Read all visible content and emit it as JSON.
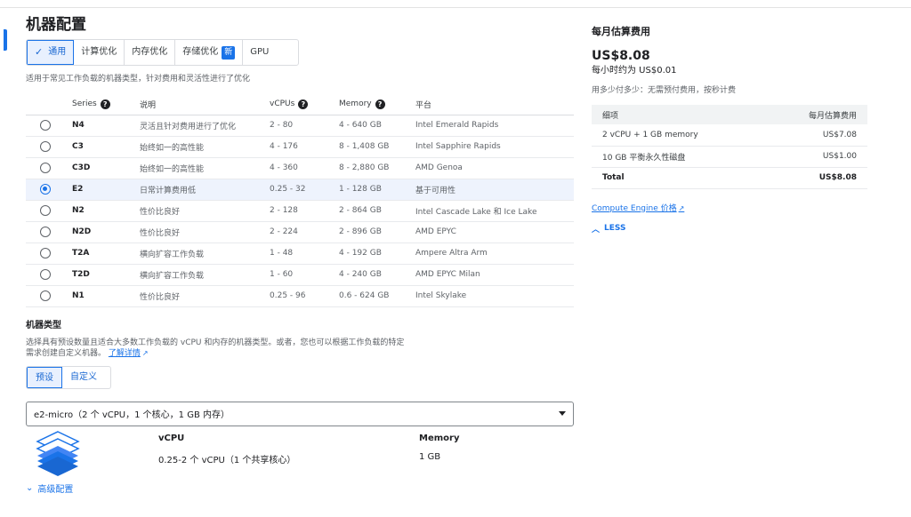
{
  "page": {
    "title": "机器配置"
  },
  "tabs": [
    {
      "label": "通用",
      "active": true
    },
    {
      "label": "计算优化"
    },
    {
      "label": "内存优化"
    },
    {
      "label": "存储优化",
      "badge": "新"
    },
    {
      "label": "GPU"
    }
  ],
  "tab_description": "适用于常见工作负载的机器类型，针对费用和灵活性进行了优化",
  "series_table": {
    "headers": {
      "series": "Series",
      "description": "说明",
      "vcpus": "vCPUs",
      "memory": "Memory",
      "platform": "平台"
    },
    "rows": [
      {
        "series": "N4",
        "description": "灵活且针对费用进行了优化",
        "vcpus": "2 - 80",
        "memory": "4 - 640 GB",
        "platform": "Intel Emerald Rapids",
        "selected": false
      },
      {
        "series": "C3",
        "description": "始终如一的高性能",
        "vcpus": "4 - 176",
        "memory": "8 - 1,408 GB",
        "platform": "Intel Sapphire Rapids",
        "selected": false
      },
      {
        "series": "C3D",
        "description": "始终如一的高性能",
        "vcpus": "4 - 360",
        "memory": "8 - 2,880 GB",
        "platform": "AMD Genoa",
        "selected": false
      },
      {
        "series": "E2",
        "description": "日常计算费用低",
        "vcpus": "0.25 - 32",
        "memory": "1 - 128 GB",
        "platform": "基于可用性",
        "selected": true
      },
      {
        "series": "N2",
        "description": "性价比良好",
        "vcpus": "2 - 128",
        "memory": "2 - 864 GB",
        "platform": "Intel Cascade Lake 和 Ice Lake",
        "selected": false
      },
      {
        "series": "N2D",
        "description": "性价比良好",
        "vcpus": "2 - 224",
        "memory": "2 - 896 GB",
        "platform": "AMD EPYC",
        "selected": false
      },
      {
        "series": "T2A",
        "description": "横向扩容工作负载",
        "vcpus": "1 - 48",
        "memory": "4 - 192 GB",
        "platform": "Ampere Altra Arm",
        "selected": false
      },
      {
        "series": "T2D",
        "description": "横向扩容工作负载",
        "vcpus": "1 - 60",
        "memory": "4 - 240 GB",
        "platform": "AMD EPYC Milan",
        "selected": false
      },
      {
        "series": "N1",
        "description": "性价比良好",
        "vcpus": "0.25 - 96",
        "memory": "0.6 - 624 GB",
        "platform": "Intel Skylake",
        "selected": false
      }
    ]
  },
  "machine_type": {
    "title": "机器类型",
    "description": "选择具有预设数量且适合大多数工作负载的 vCPU 和内存的机器类型。或者，您也可以根据工作负载的特定需求创建自定义机器。",
    "learn_more": "了解详情",
    "modes": [
      {
        "label": "预设",
        "active": true
      },
      {
        "label": "自定义"
      }
    ],
    "selected": "e2-micro（2 个 vCPU，1 个核心，1 GB 内存）",
    "spec": {
      "vcpu_label": "vCPU",
      "vcpu_value": "0.25-2 个 vCPU（1 个共享核心）",
      "memory_label": "Memory",
      "memory_value": "1 GB"
    },
    "advanced": "高级配置"
  },
  "cost": {
    "title": "每月估算费用",
    "amount": "US$8.08",
    "hourly": "每小时约为 US$0.01",
    "note": "用多少付多少：无需预付费用，按秒计费",
    "table": {
      "headers": {
        "item": "细项",
        "cost": "每月估算费用"
      },
      "rows": [
        {
          "item": "2 vCPU + 1 GB memory",
          "cost": "US$7.08"
        },
        {
          "item": "10 GB 平衡永久性磁盘",
          "cost": "US$1.00"
        }
      ],
      "total": {
        "item": "Total",
        "cost": "US$8.08"
      }
    },
    "link": "Compute Engine 价格",
    "less": "LESS"
  },
  "colors": {
    "accent": "#1a73e8",
    "selected_row": "#eef3fd",
    "header_bg": "#f1f3f4"
  }
}
